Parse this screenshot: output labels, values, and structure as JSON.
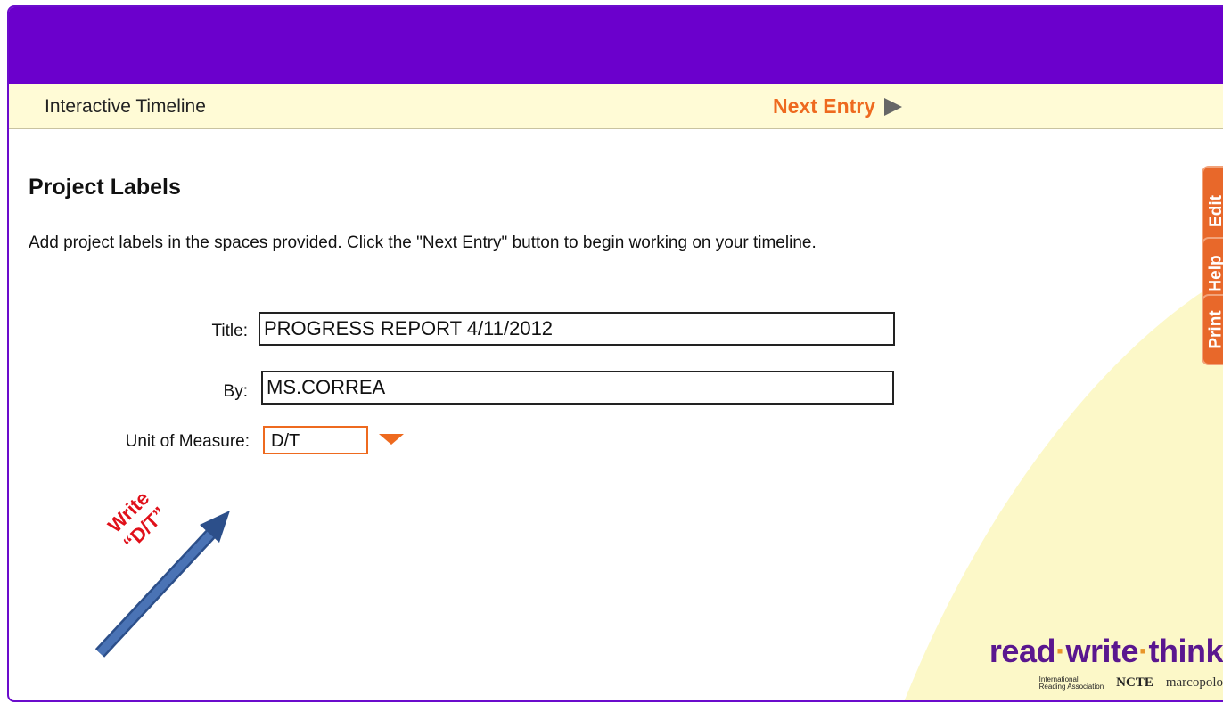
{
  "header": {
    "app_title": "Interactive Timeline",
    "next_entry_label": "Next Entry"
  },
  "main": {
    "section_title": "Project Labels",
    "instructions": "Add project labels in the spaces provided. Click the \"Next Entry\" button to begin working on your timeline.",
    "fields": {
      "title_label": "Title:",
      "title_value": "PROGRESS REPORT 4/11/2012",
      "by_label": "By:",
      "by_value": "MS.CORREA",
      "unit_label": "Unit of Measure:",
      "unit_value": "D/T"
    }
  },
  "side_tabs": {
    "edit": "Edit",
    "help": "Help",
    "print": "Print"
  },
  "annotation": {
    "line1": "Write",
    "line2": "“D/T”"
  },
  "logo": {
    "read": "read",
    "write": "write",
    "think": "think",
    "dot": "·",
    "partner_ira_1": "International",
    "partner_ira_2": "Reading Association",
    "partner_ncte": "NCTE",
    "partner_marco": "marcopolo"
  },
  "colors": {
    "header_purple": "#6b00cc",
    "accent_orange": "#ee6a1f",
    "nav_bg": "#fffbd6",
    "annotation_red": "#e0101a",
    "arrow_blue": "#4a73b5"
  }
}
